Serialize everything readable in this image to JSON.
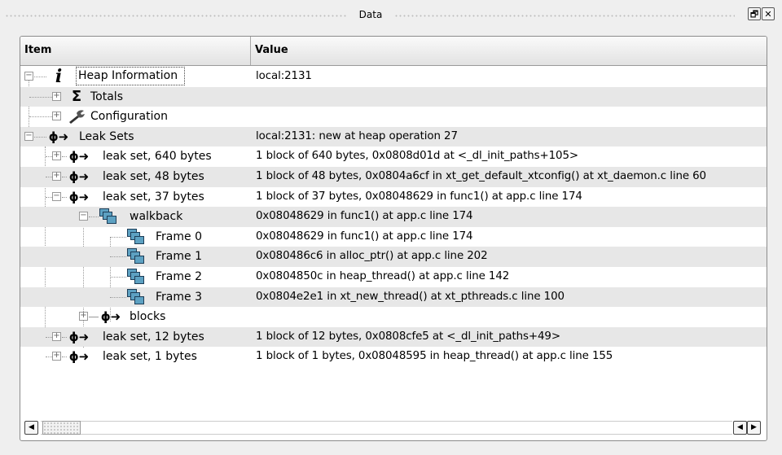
{
  "window": {
    "title": "Data",
    "float_label": "🗗",
    "close_label": "✕"
  },
  "table": {
    "headers": {
      "item": "Item",
      "value": "Value"
    },
    "rows": [
      {
        "label": "Heap Information",
        "value": "local:2131",
        "expander": "−",
        "icon": "info-icon"
      },
      {
        "label": "Totals",
        "value": "",
        "expander": "+",
        "icon": "sigma-icon"
      },
      {
        "label": "Configuration",
        "value": "",
        "expander": "+",
        "icon": "wrench-icon"
      },
      {
        "label": "Leak Sets",
        "value": "local:2131: new at heap operation 27",
        "expander": "−",
        "icon": "leak-icon"
      },
      {
        "label": "leak set, 640 bytes",
        "value": "1 block of 640 bytes, 0x0808d01d at <_dl_init_paths+105>",
        "expander": "+",
        "icon": "leak-icon"
      },
      {
        "label": "leak set, 48 bytes",
        "value": "1 block of 48 bytes, 0x0804a6cf in xt_get_default_xtconfig() at xt_daemon.c line 60",
        "expander": "+",
        "icon": "leak-icon"
      },
      {
        "label": "leak set, 37 bytes",
        "value": "1 block of 37 bytes, 0x08048629 in func1() at app.c line 174",
        "expander": "−",
        "icon": "leak-icon"
      },
      {
        "label": "walkback",
        "value": "0x08048629 in func1() at app.c line 174",
        "expander": "−",
        "icon": "frames-icon"
      },
      {
        "label": "Frame 0",
        "value": "0x08048629 in func1() at app.c line 174",
        "expander": "",
        "icon": "frames-icon"
      },
      {
        "label": "Frame 1",
        "value": "0x080486c6 in alloc_ptr() at app.c line 202",
        "expander": "",
        "icon": "frames-icon"
      },
      {
        "label": "Frame 2",
        "value": "0x0804850c in heap_thread() at app.c line 142",
        "expander": "",
        "icon": "frames-icon"
      },
      {
        "label": "Frame 3",
        "value": "0x0804e2e1 in xt_new_thread() at xt_pthreads.c line 100",
        "expander": "",
        "icon": "frames-icon"
      },
      {
        "label": "blocks",
        "value": "",
        "expander": "+",
        "icon": "leak-icon"
      },
      {
        "label": "leak set, 12 bytes",
        "value": "1 block of 12 bytes, 0x0808cfe5 at <_dl_init_paths+49>",
        "expander": "+",
        "icon": "leak-icon"
      },
      {
        "label": "leak set, 1 bytes",
        "value": "1 block of 1 bytes, 0x08048595 in heap_thread() at app.c line 155",
        "expander": "+",
        "icon": "leak-icon"
      }
    ]
  },
  "scrollbar": {
    "left_arrow": "◀",
    "right_arrow": "▶"
  },
  "colors": {
    "icon_blue": "#5da1c2",
    "row_alt": "#e7e7e7"
  }
}
